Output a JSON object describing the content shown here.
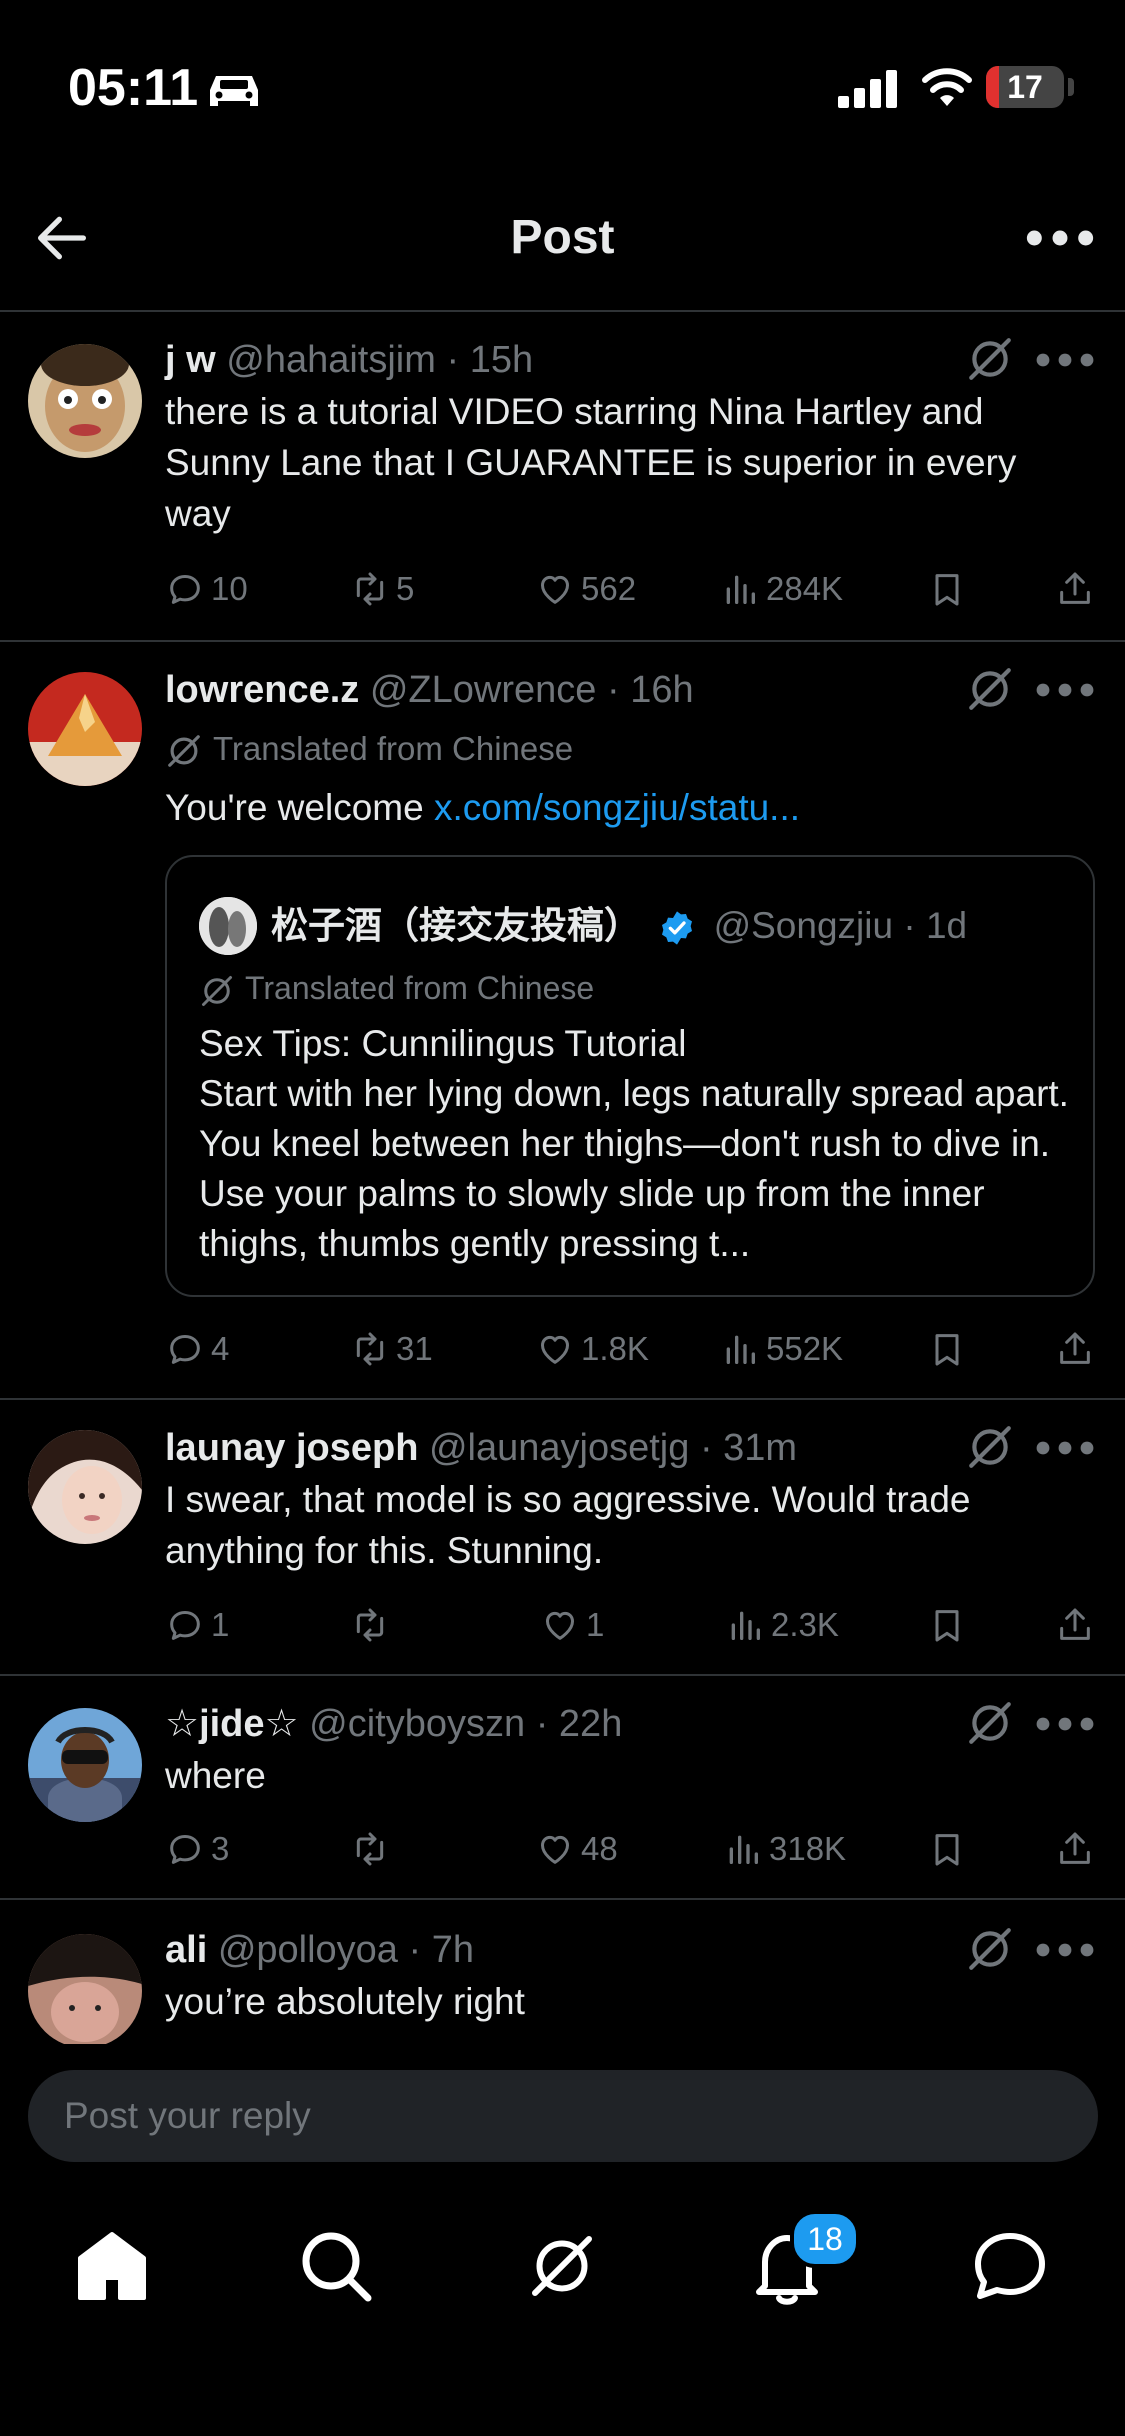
{
  "status": {
    "time": "05:11",
    "battery": "17",
    "battery_level": 0.17
  },
  "header": {
    "title": "Post"
  },
  "tweets": [
    {
      "name": "j w",
      "handle": "@hahaitsjim",
      "sep": "·",
      "time": "15h",
      "text": "there is a tutorial VIDEO starring Nina Hartley and Sunny Lane that I GUARANTEE is superior in every way",
      "replies": "10",
      "reposts": "5",
      "likes": "562",
      "views": "284K"
    },
    {
      "name": "lowrence.z",
      "handle": "@ZLowrence",
      "sep": "·",
      "time": "16h",
      "translated": "Translated from Chinese",
      "text": "You're welcome ",
      "link": "x.com/songzjiu/statu...",
      "replies": "4",
      "reposts": "31",
      "likes": "1.8K",
      "views": "552K",
      "quote": {
        "name": "松子酒（接交友投稿）",
        "handle": "@Songzjiu",
        "sep": "·",
        "time": "1d",
        "translated": "Translated from Chinese",
        "title": "Sex Tips: Cunnilingus Tutorial",
        "text": "Start with her lying down, legs naturally spread apart. You kneel between her thighs—don't rush to dive in. Use your palms to slowly slide up from the inner thighs, thumbs gently pressing t..."
      }
    },
    {
      "name": "launay joseph",
      "handle": "@launayjosetjg",
      "sep": "·",
      "time": "31m",
      "text": "I swear, that model is so aggressive. Would trade anything for this. Stunning.",
      "replies": "1",
      "reposts": "",
      "likes": "1",
      "views": "2.3K"
    },
    {
      "name": "☆jide☆",
      "handle": "@cityboyszn",
      "sep": "·",
      "time": "22h",
      "text": "where",
      "replies": "3",
      "reposts": "",
      "likes": "48",
      "views": "318K"
    },
    {
      "name": "ali",
      "handle": "@polloyoa",
      "sep": "·",
      "time": "7h",
      "text": "you’re absolutely right"
    }
  ],
  "reply": {
    "placeholder": "Post your reply"
  },
  "tabs": {
    "notifications_badge": "18"
  },
  "colors": {
    "background": "#000000",
    "text": "#e7e9ea",
    "muted": "#71767b",
    "accent": "#1d9bf0",
    "border": "#2f3336"
  },
  "icons": [
    "back-arrow-icon",
    "more-icon",
    "grok-icon",
    "reply-icon",
    "repost-icon",
    "like-icon",
    "views-icon",
    "bookmark-icon",
    "share-icon",
    "verified-icon",
    "home-icon",
    "search-icon",
    "grok-tab-icon",
    "bell-icon",
    "messages-icon"
  ]
}
